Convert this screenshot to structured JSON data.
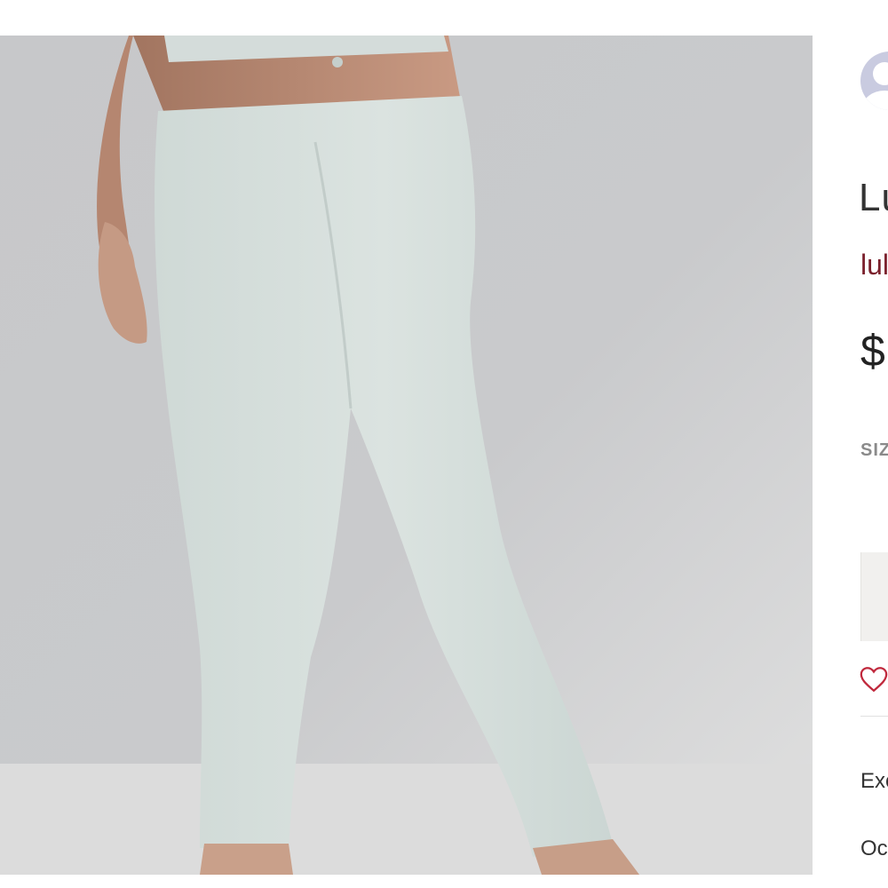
{
  "listing": {
    "title": "Lu",
    "brand": "lul",
    "price": "$",
    "size_label": "SIZ",
    "condition": "Exc",
    "date": "Oc"
  },
  "icons": {
    "avatar": "user-avatar-icon",
    "like": "heart-outline-icon"
  },
  "colors": {
    "brand": "#7a1f2b",
    "like": "#c0283c",
    "avatar_bg": "#c9cbe0"
  }
}
